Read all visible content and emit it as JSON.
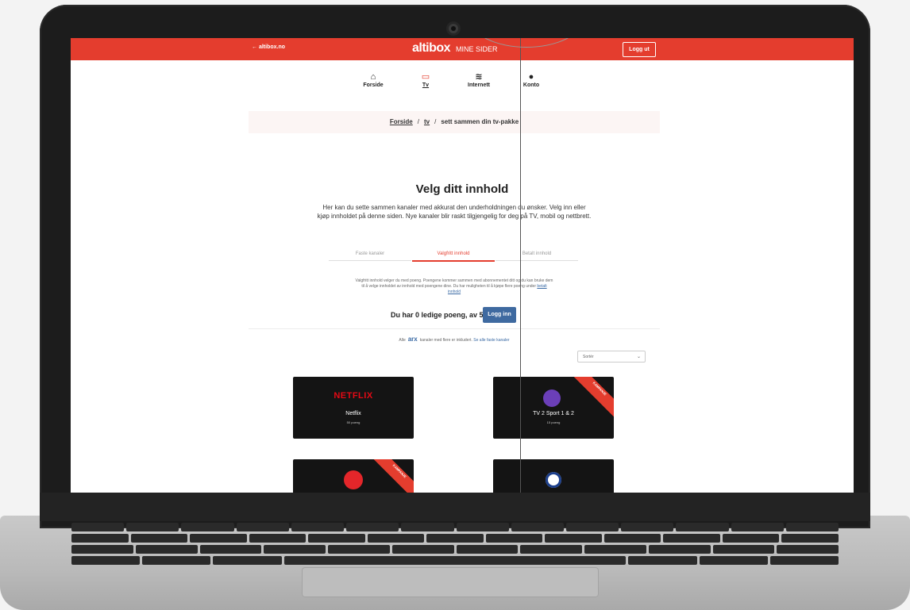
{
  "topbar": {
    "back_label": "← altibox.no",
    "brand": "altibox",
    "brand_sub": "MINE SIDER",
    "logout_label": "Logg ut",
    "color": "#e43d2e"
  },
  "nav": [
    {
      "label": "Forside",
      "icon": "house-icon"
    },
    {
      "label": "Tv",
      "icon": "tv-icon"
    },
    {
      "label": "Internett",
      "icon": "wifi-icon"
    },
    {
      "label": "Konto",
      "icon": "user-icon"
    }
  ],
  "breadcrumb": {
    "home": "Forside",
    "tv": "tv",
    "current": "sett sammen din tv-pakke"
  },
  "page": {
    "title": "Velg ditt innhold",
    "intro": "Her kan du sette sammen kanaler med akkurat den underholdningen du ønsker. Velg inn eller kjøp innholdet på denne siden. Nye kanaler blir raskt tilgjengelig for deg på TV, mobil og nettbrett."
  },
  "tabs": [
    {
      "label": "Faste kanaler"
    },
    {
      "label": "Valgfritt innhold"
    },
    {
      "label": "Betalt innhold"
    }
  ],
  "info": {
    "text": "Valgfritt innhold velger du med poeng. Poengene kommer sammen med abonnementet ditt og du kan bruke dem til å velge innholdet av innhold med poengene dine. Du har muligheten til å kjøpe flere poeng under",
    "link": "betalt innhold"
  },
  "points": {
    "text": "Du har 0 ledige poeng, av 50",
    "login_label": "Logg inn"
  },
  "alle_note": {
    "prefix": "Alle",
    "tag": "arx",
    "text": "kanaler med flere er inkludert.",
    "link": "Se alle faste kanaler"
  },
  "sort": {
    "selected": "Sortér"
  },
  "cards": [
    {
      "logo": "NETFLIX",
      "title": "Netflix",
      "points": "50 poeng"
    },
    {
      "title": "TV 2 Sport 1 & 2",
      "points": "15 poeng",
      "ribbon": "KAMPANJE"
    }
  ]
}
